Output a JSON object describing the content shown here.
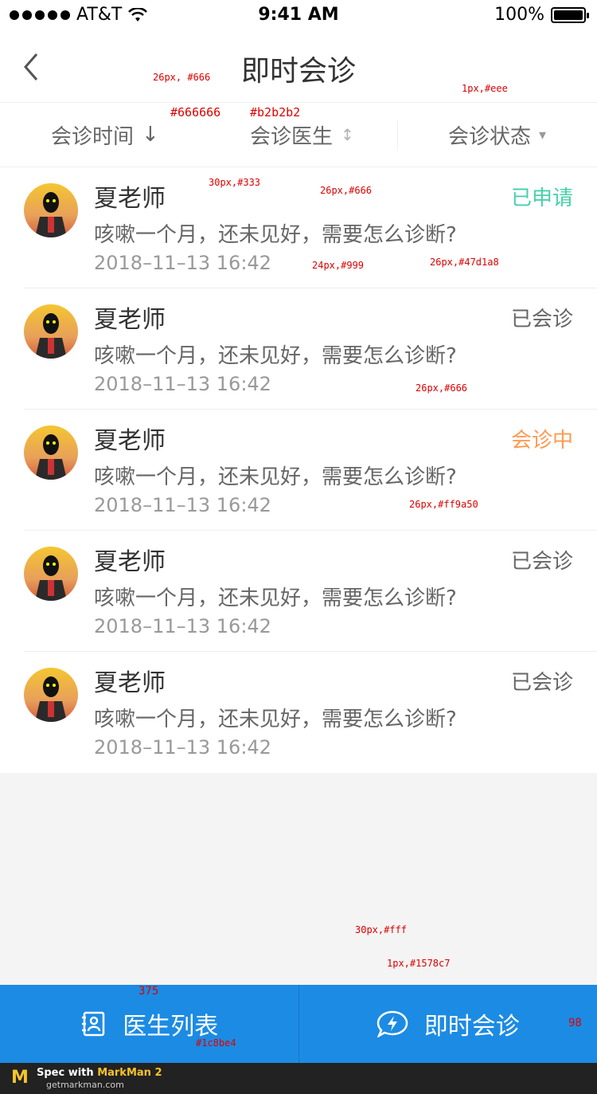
{
  "status_bar": {
    "carrier": "AT&T",
    "time": "9:41 AM",
    "battery": "100%"
  },
  "nav": {
    "title": "即时会诊"
  },
  "filters": [
    {
      "label": "会诊时间",
      "arrow": "↓"
    },
    {
      "label": "会诊医生",
      "arrow": "↕"
    },
    {
      "label": "会诊状态",
      "arrow": "▾"
    }
  ],
  "colors": {
    "applied": "#47d1a8",
    "done": "#666666",
    "in_progress": "#ff9a50",
    "tab_bg": "#1c8be4",
    "tab_divider": "#1578c7"
  },
  "consultations": [
    {
      "name": "夏老师",
      "message": "咳嗽一个月，还未见好，需要怎么诊断?",
      "time": "2018–11–13  16:42",
      "status": "已申请",
      "status_color": "#47d1a8"
    },
    {
      "name": "夏老师",
      "message": "咳嗽一个月，还未见好，需要怎么诊断?",
      "time": "2018–11–13  16:42",
      "status": "已会诊",
      "status_color": "#666666"
    },
    {
      "name": "夏老师",
      "message": "咳嗽一个月，还未见好，需要怎么诊断?",
      "time": "2018–11–13  16:42",
      "status": "会诊中",
      "status_color": "#ff9a50"
    },
    {
      "name": "夏老师",
      "message": "咳嗽一个月，还未见好，需要怎么诊断?",
      "time": "2018–11–13  16:42",
      "status": "已会诊",
      "status_color": "#666666"
    },
    {
      "name": "夏老师",
      "message": "咳嗽一个月，还未见好，需要怎么诊断?",
      "time": "2018–11–13  16:42",
      "status": "已会诊",
      "status_color": "#666666"
    }
  ],
  "tabbar": {
    "doctor_list": "医生列表",
    "instant_consult": "即时会诊"
  },
  "footer": {
    "spec_with": "Spec with",
    "brand": "MarkMan 2",
    "url": "getmarkman.com"
  },
  "annotations": {
    "a1": "26px, #666",
    "a2": "#666666",
    "a3": "#b2b2b2",
    "a4": "1px,#eee",
    "a5": "30px,#333",
    "a6": "26px,#666",
    "a7": "24px,#999",
    "a8": "26px,#47d1a8",
    "a9": "26px,#666",
    "a10": "26px,#ff9a50",
    "a11": "30px,#fff",
    "a12": "1px,#1578c7",
    "a13": "#1c8be4",
    "a14": "375",
    "a15": "98"
  }
}
